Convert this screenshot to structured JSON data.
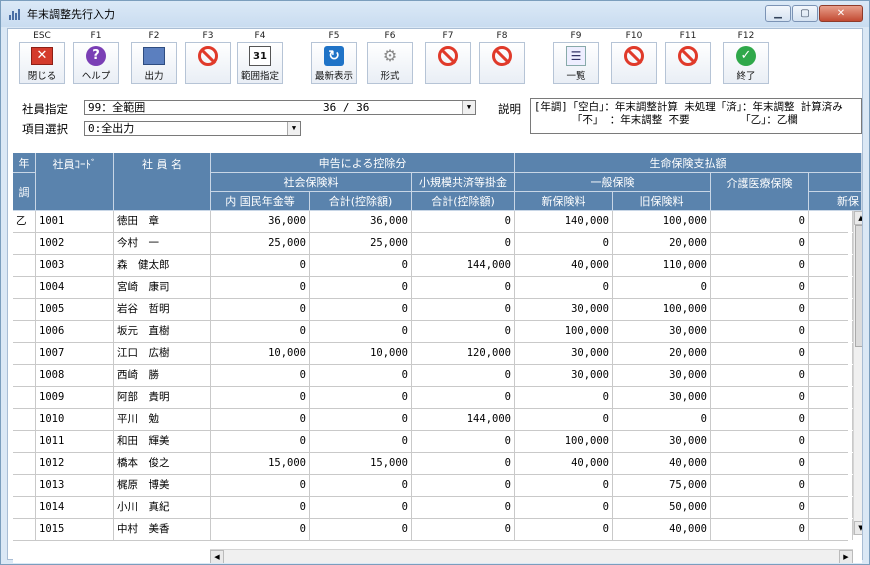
{
  "window": {
    "title": "年末調整先行入力"
  },
  "toolbar": {
    "keys": [
      {
        "key": "ESC",
        "label": "閉じる",
        "icon": "close-icon"
      },
      {
        "key": "F1",
        "label": "ヘルプ",
        "icon": "help-icon"
      },
      {
        "key": "F2",
        "label": "出力",
        "icon": "print-icon"
      },
      {
        "key": "F3",
        "label": "",
        "icon": "disabled-icon"
      },
      {
        "key": "F4",
        "label": "範囲指定",
        "icon": "calendar-icon"
      },
      {
        "key": "F5",
        "label": "最新表示",
        "icon": "refresh-icon"
      },
      {
        "key": "F6",
        "label": "形式",
        "icon": "gear-icon"
      },
      {
        "key": "F7",
        "label": "",
        "icon": "disabled-icon"
      },
      {
        "key": "F8",
        "label": "",
        "icon": "disabled-icon"
      },
      {
        "key": "F9",
        "label": "一覧",
        "icon": "list-icon"
      },
      {
        "key": "F10",
        "label": "",
        "icon": "disabled-icon"
      },
      {
        "key": "F11",
        "label": "",
        "icon": "disabled-icon"
      },
      {
        "key": "F12",
        "label": "終了",
        "icon": "check-icon"
      }
    ]
  },
  "filters": {
    "employee_label": "社員指定",
    "employee_value": "99：全範囲",
    "employee_count": "36 / 36",
    "item_label": "項目選択",
    "item_value": "0:全出力",
    "desc_label": "説明",
    "desc_line1": "[年調]「空白」：年末調整計算 未処理「済」：年末調整 計算済み",
    "desc_line2": "      「不」 ：年末調整 不要        「乙」：乙欄"
  },
  "grid": {
    "headers": {
      "nen": "年",
      "chou": "調",
      "code": "社員ｺｰﾄﾞ",
      "name": "社 員 名",
      "shinkoku": "申告による控除分",
      "seimei": "生命保険支払額",
      "shakai": "社会保険料",
      "shokibo": "小規模共済等掛金",
      "ippan": "一般保険",
      "kaigo": "介護医療保険",
      "nenkin": "内 国民年金等",
      "shakai_total": "合計(控除額)",
      "shokibo_total": "合計(控除額)",
      "shin": "新保険料",
      "kyu": "旧保険料",
      "shin2": "新保"
    },
    "rows": [
      {
        "nen": "乙",
        "code": "1001",
        "name": "徳田　章",
        "nenkin": "36,000",
        "shakai": "36,000",
        "shokibo": "0",
        "shin": "140,000",
        "kyu": "100,000",
        "kaigo": "0"
      },
      {
        "nen": "",
        "code": "1002",
        "name": "今村　一",
        "nenkin": "25,000",
        "shakai": "25,000",
        "shokibo": "0",
        "shin": "0",
        "kyu": "20,000",
        "kaigo": "0"
      },
      {
        "nen": "",
        "code": "1003",
        "name": "森　健太郎",
        "nenkin": "0",
        "shakai": "0",
        "shokibo": "144,000",
        "shin": "40,000",
        "kyu": "110,000",
        "kaigo": "0"
      },
      {
        "nen": "",
        "code": "1004",
        "name": "宮崎　康司",
        "nenkin": "0",
        "shakai": "0",
        "shokibo": "0",
        "shin": "0",
        "kyu": "0",
        "kaigo": "0"
      },
      {
        "nen": "",
        "code": "1005",
        "name": "岩谷　哲明",
        "nenkin": "0",
        "shakai": "0",
        "shokibo": "0",
        "shin": "30,000",
        "kyu": "100,000",
        "kaigo": "0"
      },
      {
        "nen": "",
        "code": "1006",
        "name": "坂元　直樹",
        "nenkin": "0",
        "shakai": "0",
        "shokibo": "0",
        "shin": "100,000",
        "kyu": "30,000",
        "kaigo": "0"
      },
      {
        "nen": "",
        "code": "1007",
        "name": "江口　広樹",
        "nenkin": "10,000",
        "shakai": "10,000",
        "shokibo": "120,000",
        "shin": "30,000",
        "kyu": "20,000",
        "kaigo": "0"
      },
      {
        "nen": "",
        "code": "1008",
        "name": "西崎　勝",
        "nenkin": "0",
        "shakai": "0",
        "shokibo": "0",
        "shin": "30,000",
        "kyu": "30,000",
        "kaigo": "0"
      },
      {
        "nen": "",
        "code": "1009",
        "name": "阿部　貴明",
        "nenkin": "0",
        "shakai": "0",
        "shokibo": "0",
        "shin": "0",
        "kyu": "30,000",
        "kaigo": "0"
      },
      {
        "nen": "",
        "code": "1010",
        "name": "平川　勉",
        "nenkin": "0",
        "shakai": "0",
        "shokibo": "144,000",
        "shin": "0",
        "kyu": "0",
        "kaigo": "0"
      },
      {
        "nen": "",
        "code": "1011",
        "name": "和田　輝美",
        "nenkin": "0",
        "shakai": "0",
        "shokibo": "0",
        "shin": "100,000",
        "kyu": "30,000",
        "kaigo": "0"
      },
      {
        "nen": "",
        "code": "1012",
        "name": "橋本　俊之",
        "nenkin": "15,000",
        "shakai": "15,000",
        "shokibo": "0",
        "shin": "40,000",
        "kyu": "40,000",
        "kaigo": "0"
      },
      {
        "nen": "",
        "code": "1013",
        "name": "梶原　博美",
        "nenkin": "0",
        "shakai": "0",
        "shokibo": "0",
        "shin": "0",
        "kyu": "75,000",
        "kaigo": "0"
      },
      {
        "nen": "",
        "code": "1014",
        "name": "小川　真紀",
        "nenkin": "0",
        "shakai": "0",
        "shokibo": "0",
        "shin": "0",
        "kyu": "50,000",
        "kaigo": "0"
      },
      {
        "nen": "",
        "code": "1015",
        "name": "中村　美香",
        "nenkin": "0",
        "shakai": "0",
        "shokibo": "0",
        "shin": "0",
        "kyu": "40,000",
        "kaigo": "0"
      }
    ]
  }
}
